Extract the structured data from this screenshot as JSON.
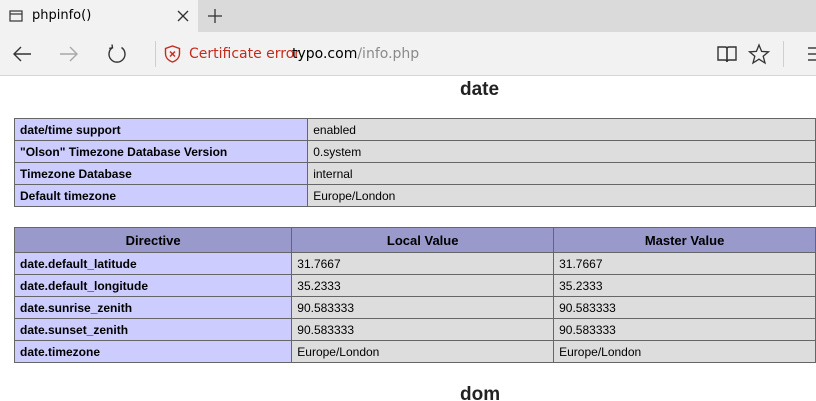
{
  "browser": {
    "tab_title": "phpinfo()",
    "cert_error": "Certificate error",
    "url_host": "typo.com",
    "url_path": "/info.php"
  },
  "sections": {
    "date_title": "date",
    "next_title": "dom"
  },
  "info_table": [
    {
      "name": "date/time support",
      "value": "enabled"
    },
    {
      "name": "\"Olson\" Timezone Database Version",
      "value": "0.system"
    },
    {
      "name": "Timezone Database",
      "value": "internal"
    },
    {
      "name": "Default timezone",
      "value": "Europe/London"
    }
  ],
  "directive_table": {
    "headers": [
      "Directive",
      "Local Value",
      "Master Value"
    ],
    "rows": [
      {
        "directive": "date.default_latitude",
        "local": "31.7667",
        "master": "31.7667"
      },
      {
        "directive": "date.default_longitude",
        "local": "35.2333",
        "master": "35.2333"
      },
      {
        "directive": "date.sunrise_zenith",
        "local": "90.583333",
        "master": "90.583333"
      },
      {
        "directive": "date.sunset_zenith",
        "local": "90.583333",
        "master": "90.583333"
      },
      {
        "directive": "date.timezone",
        "local": "Europe/London",
        "master": "Europe/London"
      }
    ]
  },
  "colors": {
    "header_bg": "#9999cc",
    "name_bg": "#ccccff",
    "value_bg": "#dddddd",
    "cert_error": "#c42b1c"
  }
}
